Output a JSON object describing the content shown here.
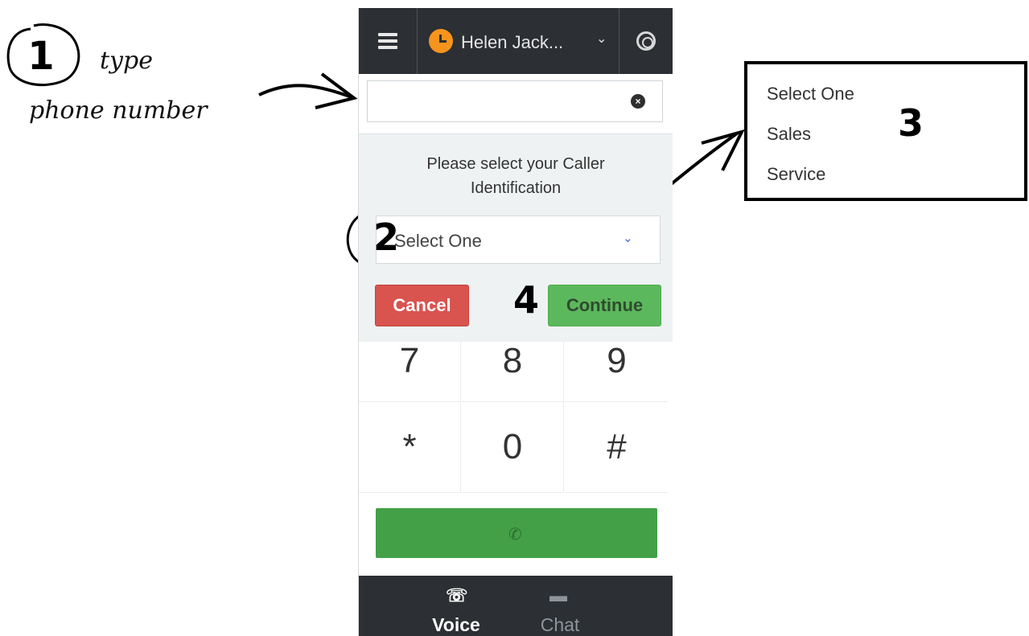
{
  "annotations": {
    "step1_number": "1",
    "step1_line1": "type",
    "step1_line2": "phone number",
    "step2_number": "2",
    "step3_number": "3",
    "step4_number": "4"
  },
  "header": {
    "menu_icon": "hamburger-icon",
    "agent_status_icon": "clock-icon",
    "agent_status_color": "#f7941d",
    "agent_name": "Helen Jack...",
    "agent_chevron": "⌄",
    "help_icon": "lifebuoy-icon"
  },
  "phone_input": {
    "value": "",
    "clear_icon": "clear-icon",
    "clear_glyph": "×"
  },
  "caller_id": {
    "prompt": "Please select your Caller Identification",
    "selected": "Select One",
    "chevron": "⌄",
    "options": [
      "Select One",
      "Sales",
      "Service"
    ],
    "cancel_label": "Cancel",
    "continue_label": "Continue"
  },
  "keypad": {
    "row1": [
      "7",
      "8",
      "9"
    ],
    "row2": [
      "*",
      "0",
      "#"
    ]
  },
  "call_button": {
    "icon": "phone-icon",
    "glyph": "✆",
    "color": "#43a047"
  },
  "tabs": [
    {
      "label": "Voice",
      "icon": "voice-icon",
      "glyph": "☏",
      "active": true
    },
    {
      "label": "Chat",
      "icon": "chat-icon",
      "glyph": "▬",
      "active": false
    }
  ]
}
